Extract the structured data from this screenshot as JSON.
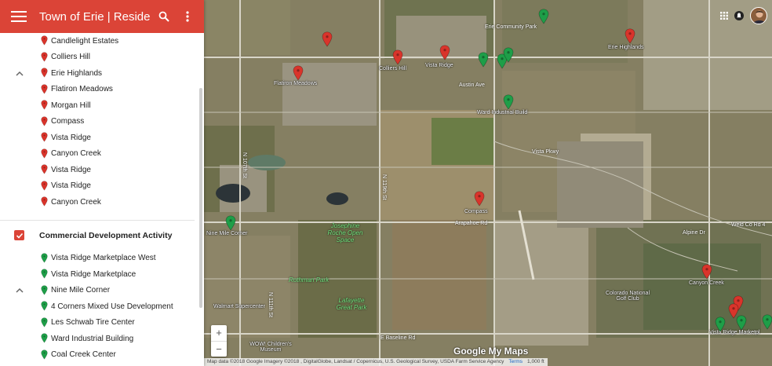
{
  "header": {
    "title": "Town of Erie | Residenti..."
  },
  "residential_items": [
    {
      "label": "Candlelight Estates"
    },
    {
      "label": "Colliers Hill"
    },
    {
      "label": "Erie Highlands"
    },
    {
      "label": "Flatiron Meadows"
    },
    {
      "label": "Morgan Hill"
    },
    {
      "label": "Compass"
    },
    {
      "label": "Vista Ridge"
    },
    {
      "label": "Canyon Creek"
    },
    {
      "label": "Vista Ridge"
    },
    {
      "label": "Vista Ridge"
    },
    {
      "label": "Canyon Creek"
    }
  ],
  "commercial_layer": {
    "title": "Commercial Development Activity",
    "checked": true,
    "items": [
      {
        "label": "Vista Ridge Marketplace West"
      },
      {
        "label": "Vista Ridge Marketplace"
      },
      {
        "label": "Nine Mile Corner"
      },
      {
        "label": "4 Corners Mixed Use Development"
      },
      {
        "label": "Les Schwab Tire Center"
      },
      {
        "label": "Ward Industrial Building"
      },
      {
        "label": "Coal Creek Center"
      }
    ]
  },
  "colors": {
    "accent": "#db4437",
    "residential_pin": "#d9342b",
    "commercial_pin": "#1e9e48"
  },
  "map": {
    "labels": {
      "erie_community_park": "Erie Community Park",
      "erie_highlands": "Erie Highlands",
      "flatiron_meadows": "Flatiron Meadows",
      "colliers_hill": "Colliers Hill",
      "vista_ridge": "Vista Ridge",
      "ward_industrial": "Ward Industrial Build",
      "compass": "Compass",
      "canyon_creek": "Canyon Creek",
      "nine_mile_corner": "Nine Mile Corner",
      "vista_ridge_mw": "Vista Ridge Marketpl",
      "walmart": "Walmart Supercenter",
      "wow_museum": "WOW! Children's Museum",
      "colorado_golf": "Colorado National Golf Club",
      "josephine_park": "Josephine Roche Open Space",
      "rothman_park": "Rothman Park",
      "lafayette_park": "Lafayette Great Park",
      "austin_ave": "Austin Ave",
      "arapahoe_rd": "Arapahoe Rd",
      "baseline_rd": "E Baseline Rd",
      "vista_pkwy": "Vista Pkwy",
      "weld_co_rd": "Weld Co Rd 4",
      "alpine_dr": "Alpine Dr",
      "n_119th": "N 119th St",
      "n_111th": "N 111th St",
      "n_107th": "N 107th St"
    },
    "logo": "Google My Maps",
    "attribution": "Map data ©2018 Google Imagery ©2018 , DigitalGlobe, Landsat / Copernicus, U.S. Geological Survey, USDA Farm Service Agency",
    "terms": "Terms",
    "scale": "1,000 ft",
    "zoom_in": "+",
    "zoom_out": "−"
  }
}
